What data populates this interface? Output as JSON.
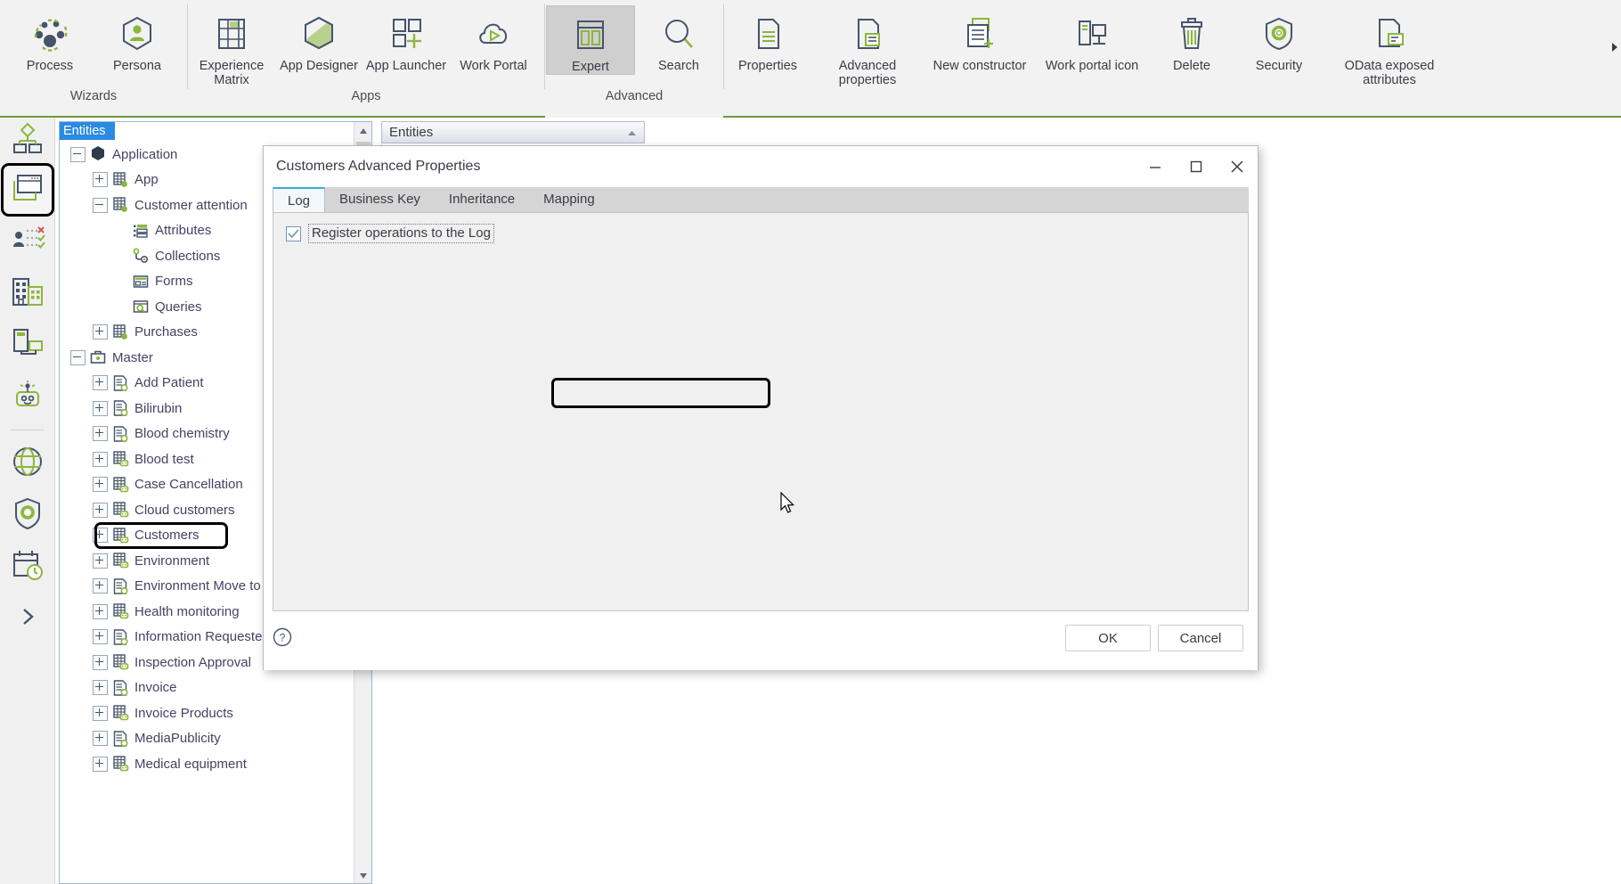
{
  "ribbon": {
    "groups": [
      {
        "label": "Wizards",
        "items": [
          {
            "label": "Process",
            "icon": "process-icon",
            "width": "normal"
          },
          {
            "label": "Persona",
            "icon": "persona-icon",
            "width": "normal"
          }
        ]
      },
      {
        "label": "Apps",
        "items": [
          {
            "label": "Experience Matrix",
            "icon": "experience-matrix-icon",
            "width": "normal"
          },
          {
            "label": "App Designer",
            "icon": "app-designer-icon",
            "width": "normal"
          },
          {
            "label": "App Launcher",
            "icon": "app-launcher-icon",
            "width": "normal"
          },
          {
            "label": "Work Portal",
            "icon": "work-portal-icon",
            "width": "normal"
          }
        ]
      },
      {
        "label": "Advanced",
        "items": [
          {
            "label": "Expert",
            "icon": "expert-icon",
            "width": "normal",
            "active": true
          },
          {
            "label": "Search",
            "icon": "search-icon",
            "width": "normal"
          }
        ]
      },
      {
        "label": "",
        "items": [
          {
            "label": "Properties",
            "icon": "properties-icon",
            "width": "normal"
          },
          {
            "label": "Advanced properties",
            "icon": "advanced-properties-icon",
            "width": "wide"
          },
          {
            "label": "New constructor",
            "icon": "new-constructor-icon",
            "width": "wide"
          },
          {
            "label": "Work portal icon",
            "icon": "work-portal-icon-icon",
            "width": "wide"
          },
          {
            "label": "Delete",
            "icon": "delete-icon",
            "width": "normal"
          },
          {
            "label": "Security",
            "icon": "security-icon",
            "width": "normal"
          },
          {
            "label": "OData exposed attributes",
            "icon": "odata-exposed-attributes-icon",
            "width": "wide"
          }
        ]
      }
    ]
  },
  "rail": {
    "items": [
      {
        "name": "diagram-icon",
        "selected": false
      },
      {
        "name": "screens-icon",
        "selected": true
      },
      {
        "name": "roles-icon",
        "selected": false
      },
      {
        "name": "organization-icon",
        "selected": false
      },
      {
        "name": "devices-icon",
        "selected": false
      },
      {
        "name": "bot-icon",
        "selected": false
      },
      {
        "name": "integrations-icon",
        "selected": false
      },
      {
        "name": "security-shield-icon",
        "selected": false
      },
      {
        "name": "scheduler-icon",
        "selected": false
      },
      {
        "name": "expand-chevron-icon",
        "selected": false
      }
    ]
  },
  "tree": {
    "header": "Entities",
    "nodes": [
      {
        "label": "Application",
        "indent": 0,
        "expander": "minus",
        "icon": "module-icon"
      },
      {
        "label": "App",
        "indent": 1,
        "expander": "plus",
        "icon": "entity-icon"
      },
      {
        "label": "Customer attention",
        "indent": 1,
        "expander": "minus",
        "icon": "entity-icon"
      },
      {
        "label": "Attributes",
        "indent": 2,
        "expander": "none",
        "icon": "attributes-icon"
      },
      {
        "label": "Collections",
        "indent": 2,
        "expander": "none",
        "icon": "collections-icon"
      },
      {
        "label": "Forms",
        "indent": 2,
        "expander": "none",
        "icon": "forms-icon"
      },
      {
        "label": "Queries",
        "indent": 2,
        "expander": "none",
        "icon": "queries-icon"
      },
      {
        "label": "Purchases",
        "indent": 1,
        "expander": "plus",
        "icon": "entity-icon"
      },
      {
        "label": "Master",
        "indent": 0,
        "expander": "minus",
        "icon": "briefcase-icon"
      },
      {
        "label": "Add Patient",
        "indent": 1,
        "expander": "plus",
        "icon": "doc-entity-icon"
      },
      {
        "label": "Bilirubin",
        "indent": 1,
        "expander": "plus",
        "icon": "doc-entity-icon"
      },
      {
        "label": "Blood chemistry",
        "indent": 1,
        "expander": "plus",
        "icon": "doc-entity-icon"
      },
      {
        "label": "Blood test",
        "indent": 1,
        "expander": "plus",
        "icon": "table-entity-icon"
      },
      {
        "label": "Case Cancellation",
        "indent": 1,
        "expander": "plus",
        "icon": "table-entity-icon"
      },
      {
        "label": "Cloud customers",
        "indent": 1,
        "expander": "plus",
        "icon": "table-entity-icon"
      },
      {
        "label": "Customers",
        "indent": 1,
        "expander": "plus",
        "icon": "table-entity-icon",
        "highlighted": true
      },
      {
        "label": "Environment",
        "indent": 1,
        "expander": "plus",
        "icon": "table-entity-icon"
      },
      {
        "label": "Environment Move to Pass",
        "indent": 1,
        "expander": "plus",
        "icon": "doc-entity-icon"
      },
      {
        "label": "Health monitoring",
        "indent": 1,
        "expander": "plus",
        "icon": "table-entity-icon"
      },
      {
        "label": "Information Requested",
        "indent": 1,
        "expander": "plus",
        "icon": "doc-entity-icon"
      },
      {
        "label": "Inspection Approval",
        "indent": 1,
        "expander": "plus",
        "icon": "table-entity-icon"
      },
      {
        "label": "Invoice",
        "indent": 1,
        "expander": "plus",
        "icon": "doc-entity-icon"
      },
      {
        "label": "Invoice Products",
        "indent": 1,
        "expander": "plus",
        "icon": "table-entity-icon"
      },
      {
        "label": "MediaPublicity",
        "indent": 1,
        "expander": "plus",
        "icon": "doc-entity-icon"
      },
      {
        "label": "Medical equipment",
        "indent": 1,
        "expander": "plus",
        "icon": "table-entity-icon"
      }
    ]
  },
  "document": {
    "tab_label": "Entities",
    "root_label": "Application"
  },
  "dialog": {
    "title": "Customers Advanced Properties",
    "tabs": [
      {
        "label": "Log",
        "active": true
      },
      {
        "label": "Business Key",
        "active": false
      },
      {
        "label": "Inheritance",
        "active": false
      },
      {
        "label": "Mapping",
        "active": false
      }
    ],
    "checkbox": {
      "label": "Register operations to the Log",
      "checked": true
    },
    "buttons": {
      "ok": "OK",
      "cancel": "Cancel"
    },
    "window_controls": {
      "minimize": "minimize-icon",
      "maximize": "maximize-icon",
      "close": "close-icon"
    },
    "help": "help-icon"
  },
  "colors": {
    "accent_green": "#7fad3e",
    "dark_slate": "#46546a",
    "tree_text": "#4a3f62",
    "selection_blue": "#2b8ae2",
    "tab_underline": "#35b0d3"
  }
}
